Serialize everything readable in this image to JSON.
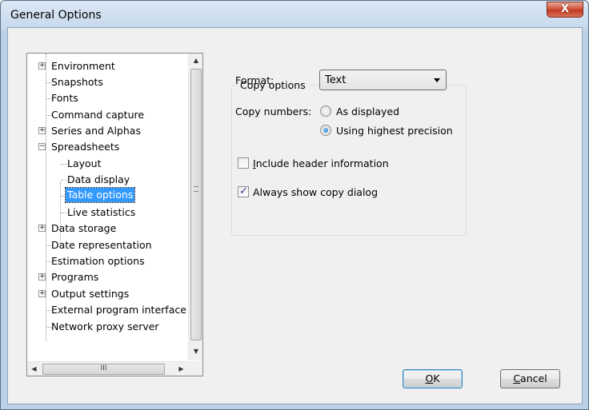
{
  "window": {
    "title": "General Options",
    "close_label": "X"
  },
  "tree": {
    "items": [
      {
        "label": "Environment",
        "expander": "+"
      },
      {
        "label": "Snapshots"
      },
      {
        "label": "Fonts"
      },
      {
        "label": "Command capture"
      },
      {
        "label": "Series and Alphas",
        "expander": "+"
      },
      {
        "label": "Spreadsheets",
        "expander": "−"
      },
      {
        "label": "Layout"
      },
      {
        "label": "Data display"
      },
      {
        "label": "Table options",
        "selected": true
      },
      {
        "label": "Live statistics"
      },
      {
        "label": "Data storage",
        "expander": "+"
      },
      {
        "label": "Date representation"
      },
      {
        "label": "Estimation options"
      },
      {
        "label": "Programs",
        "expander": "+"
      },
      {
        "label": "Output settings",
        "expander": "+"
      },
      {
        "label": "External program interface"
      },
      {
        "label": "Network proxy server"
      }
    ],
    "hscroll_thumb_label": "III"
  },
  "copy_options": {
    "legend": "Copy options",
    "format_label": "Format:",
    "format_value": "Text",
    "copy_numbers_label": "Copy numbers:",
    "radio_as_displayed": "As displayed",
    "radio_highest_precision": "Using highest precision",
    "include_header_pre": "",
    "include_header_mnemonic": "I",
    "include_header_post": "nclude header information",
    "always_show_label": "Always show copy dialog"
  },
  "buttons": {
    "ok_mnemonic": "O",
    "ok_rest": "K",
    "cancel_mnemonic": "C",
    "cancel_rest": "ancel"
  },
  "colors": {
    "selection": "#3399ff",
    "close_button": "#c23a22"
  }
}
